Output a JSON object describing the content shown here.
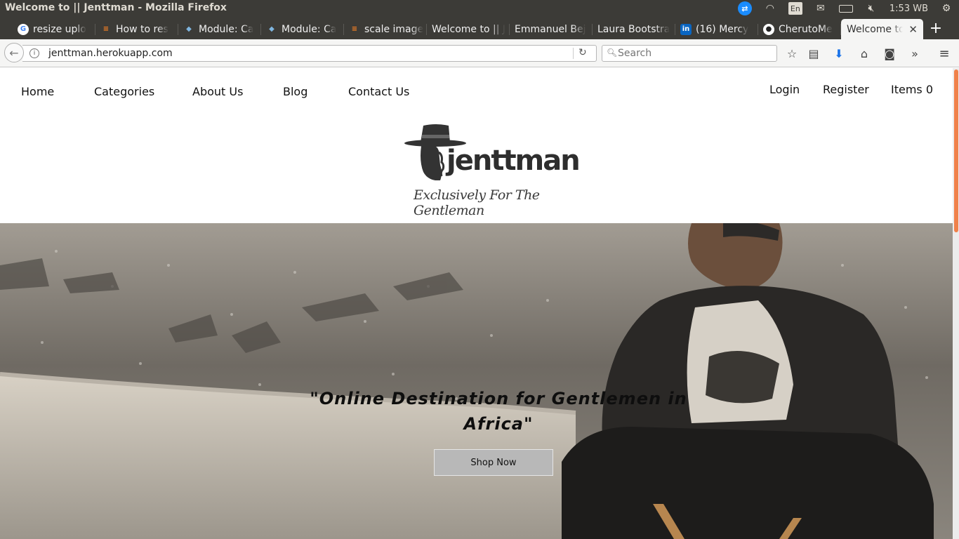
{
  "window": {
    "title": "Welcome to || Jenttman - Mozilla Firefox"
  },
  "tray": {
    "keyboard": "En",
    "clock": "1:53 WB"
  },
  "tabs": [
    {
      "label": "resize uplo",
      "icon": "google-icon"
    },
    {
      "label": "How to res",
      "icon": "stackoverflow-icon"
    },
    {
      "label": "Module: Ca",
      "icon": "module-icon"
    },
    {
      "label": "Module: Ca",
      "icon": "module-icon"
    },
    {
      "label": "scale image",
      "icon": "stackoverflow-icon"
    },
    {
      "label": "Welcome to || J",
      "icon": ""
    },
    {
      "label": "Emmanuel Bej",
      "icon": ""
    },
    {
      "label": "Laura Bootstra",
      "icon": ""
    },
    {
      "label": "(16) Mercy",
      "icon": "linkedin-icon"
    },
    {
      "label": "CherutoMe",
      "icon": "github-icon"
    },
    {
      "label": "Welcome to",
      "icon": "",
      "active": true
    }
  ],
  "toolbar": {
    "url": "jenttman.herokuapp.com",
    "search_placeholder": "Search"
  },
  "site": {
    "nav": [
      "Home",
      "Categories",
      "About Us",
      "Blog",
      "Contact Us"
    ],
    "account": {
      "login": "Login",
      "register": "Register",
      "items": "Items 0"
    },
    "logo_text": "jenttman",
    "tagline": "Exclusively For The Gentleman",
    "hero": {
      "quote": "\"Online Destination for Gentlemen in Africa\"",
      "button": "Shop Now"
    }
  },
  "colors": {
    "accent": "#f0814a",
    "chrome": "#3c3b37",
    "button": "#b8b8b8"
  }
}
